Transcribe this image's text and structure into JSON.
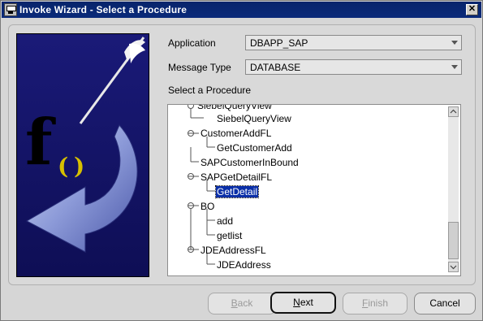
{
  "window": {
    "title": "Invoke Wizard - Select a Procedure",
    "close_glyph": "✕"
  },
  "form": {
    "application_label": "Application",
    "application_value": "DBAPP_SAP",
    "message_type_label": "Message Type",
    "message_type_value": "DATABASE",
    "procedure_label": "Select a Procedure"
  },
  "illustration": {
    "glyph": "f",
    "parens": "()"
  },
  "tree": {
    "items": [
      {
        "label": "SiebelQueryView"
      },
      {
        "label": "SiebelQueryView"
      },
      {
        "label": "CustomerAddFL"
      },
      {
        "label": "GetCustomerAdd"
      },
      {
        "label": "SAPCustomerInBound"
      },
      {
        "label": "SAPGetDetailFL"
      },
      {
        "label": "GetDetail"
      },
      {
        "label": "BO"
      },
      {
        "label": "add"
      },
      {
        "label": "getlist"
      },
      {
        "label": "JDEAddressFL"
      },
      {
        "label": "JDEAddress"
      }
    ]
  },
  "buttons": {
    "back_u": "B",
    "back_rest": "ack",
    "next_u": "N",
    "next_rest": "ext",
    "finish_u": "F",
    "finish_rest": "inish",
    "cancel": "Cancel"
  }
}
